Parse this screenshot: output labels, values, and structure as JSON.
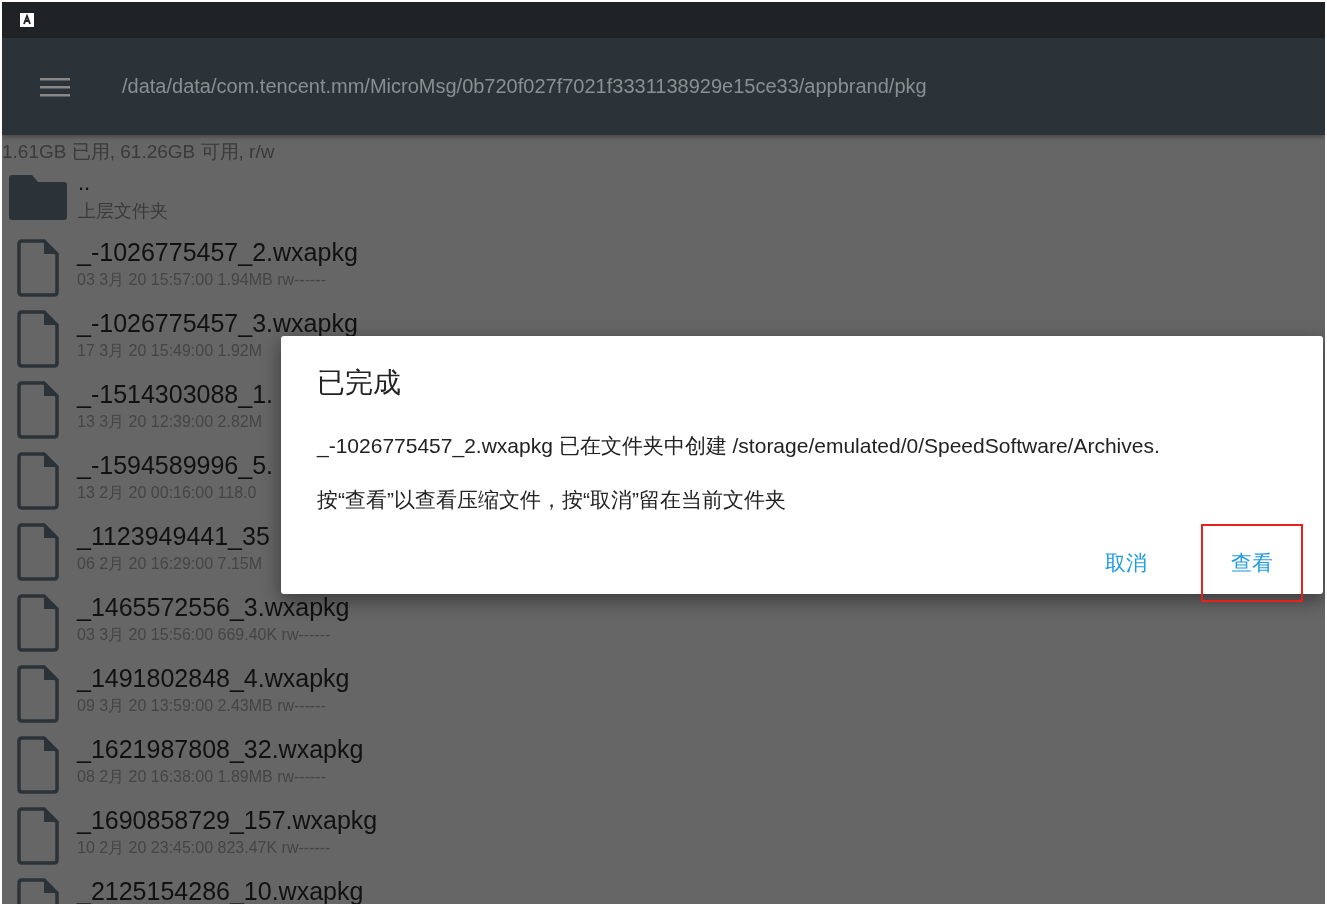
{
  "toolbar": {
    "path": "/data/data/com.tencent.mm/MicroMsg/0b720f027f7021f3331138929e15ce33/appbrand/pkg"
  },
  "storage_info": "1.61GB 已用, 61.26GB 可用, r/w",
  "entries": [
    {
      "kind": "folder",
      "name": "..",
      "detail": "上层文件夹"
    },
    {
      "kind": "file",
      "name": "_-1026775457_2.wxapkg",
      "detail": "03 3月 20 15:57:00  1.94MB  rw------"
    },
    {
      "kind": "file",
      "name": "_-1026775457_3.wxapkg",
      "detail": "17 3月 20 15:49:00  1.92M"
    },
    {
      "kind": "file",
      "name": "_-1514303088_1.",
      "detail": "13 3月 20 12:39:00  2.82M"
    },
    {
      "kind": "file",
      "name": "_-1594589996_5.",
      "detail": "13 2月 20 00:16:00  118.0"
    },
    {
      "kind": "file",
      "name": "_1123949441_35",
      "detail": "06 2月 20 16:29:00  7.15M"
    },
    {
      "kind": "file",
      "name": "_1465572556_3.wxapkg",
      "detail": "03 3月 20 15:56:00  669.40K  rw------"
    },
    {
      "kind": "file",
      "name": "_1491802848_4.wxapkg",
      "detail": "09 3月 20 13:59:00  2.43MB  rw------"
    },
    {
      "kind": "file",
      "name": "_1621987808_32.wxapkg",
      "detail": "08 2月 20 16:38:00  1.89MB  rw------"
    },
    {
      "kind": "file",
      "name": "_1690858729_157.wxapkg",
      "detail": "10 2月 20 23:45:00  823.47K  rw------"
    },
    {
      "kind": "file",
      "name": "_2125154286_10.wxapkg"
    }
  ],
  "dialog": {
    "title": "已完成",
    "message": "_-1026775457_2.wxapkg 已在文件夹中创建 /storage/emulated/0/SpeedSoftware/Archives.",
    "hint": "按“查看”以查看压缩文件，按“取消”留在当前文件夹",
    "buttons": [
      {
        "label": "取消",
        "highlighted": false
      },
      {
        "label": "查看",
        "highlighted": true
      }
    ]
  }
}
